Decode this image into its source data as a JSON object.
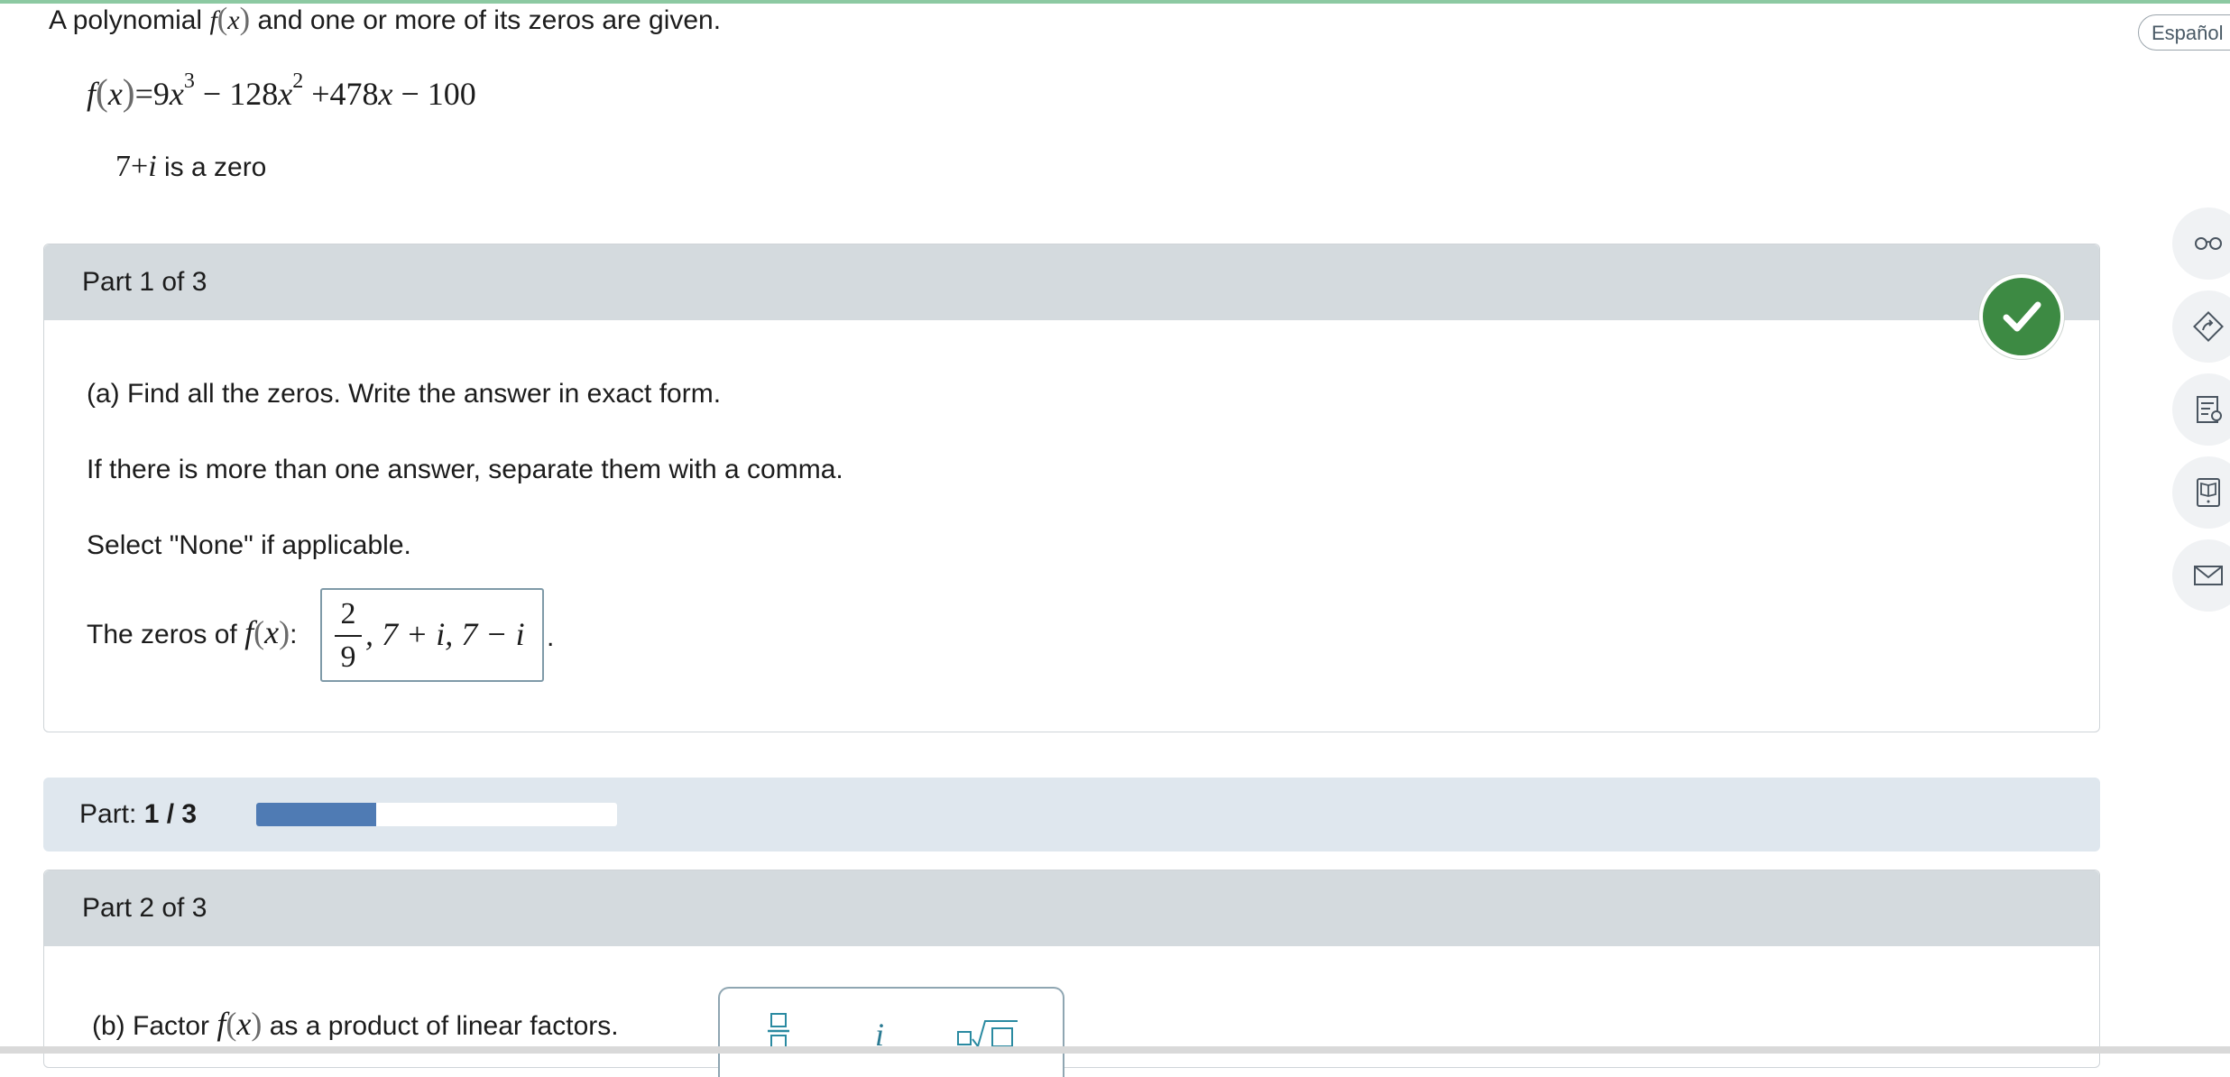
{
  "problem": {
    "intro_prefix": "A polynomial",
    "intro_fx": "f",
    "intro_x": "x",
    "intro_suffix": "and one or more of its zeros are given.",
    "equation": {
      "lhs_f": "f",
      "lhs_x": "x",
      "eq": "=",
      "t1": "9",
      "t1_var": "x",
      "t1_exp": "3",
      "op1": "−",
      "t2": "128",
      "t2_var": "x",
      "t2_exp": "2",
      "op2": "+",
      "t3": "478",
      "t3_var": "x",
      "op3": "−",
      "t4": "100"
    },
    "given_zero": {
      "value_num": "7",
      "value_op": "+",
      "value_i": "i",
      "text": "is a zero"
    }
  },
  "part1": {
    "header": "Part 1 of 3",
    "status": "correct",
    "question_a": "(a) Find all the zeros. Write the answer in exact form.",
    "instruction_1": "If there is more than one answer, separate them with a comma.",
    "instruction_2": "Select \"None\" if applicable.",
    "answer_label_prefix": "The zeros of",
    "answer_label_f": "f",
    "answer_label_x": "x",
    "answer_label_colon": ":",
    "answer": {
      "frac_num": "2",
      "frac_den": "9",
      "rest": ", 7 + i, 7 − i"
    },
    "answer_period": "."
  },
  "progress": {
    "label": "Part:",
    "value_text": "1 / 3",
    "fraction": 0.333
  },
  "part2": {
    "header": "Part 2 of 3",
    "question_prefix": "(b) Factor",
    "question_f": "f",
    "question_x": "x",
    "question_suffix": "as a product of linear factors.",
    "palette": {
      "btn1": "fraction-template",
      "btn2": "i",
      "btn3": "nth-root-template"
    }
  },
  "sidebar": {
    "language_button": "Español",
    "tools": [
      "glasses-icon",
      "calculator-arrow-icon",
      "notes-icon",
      "ebook-icon",
      "mail-icon"
    ]
  },
  "colors": {
    "correct": "#3d8a43",
    "progress_fill": "#4f7bb4",
    "header_bg": "#d4dade"
  }
}
